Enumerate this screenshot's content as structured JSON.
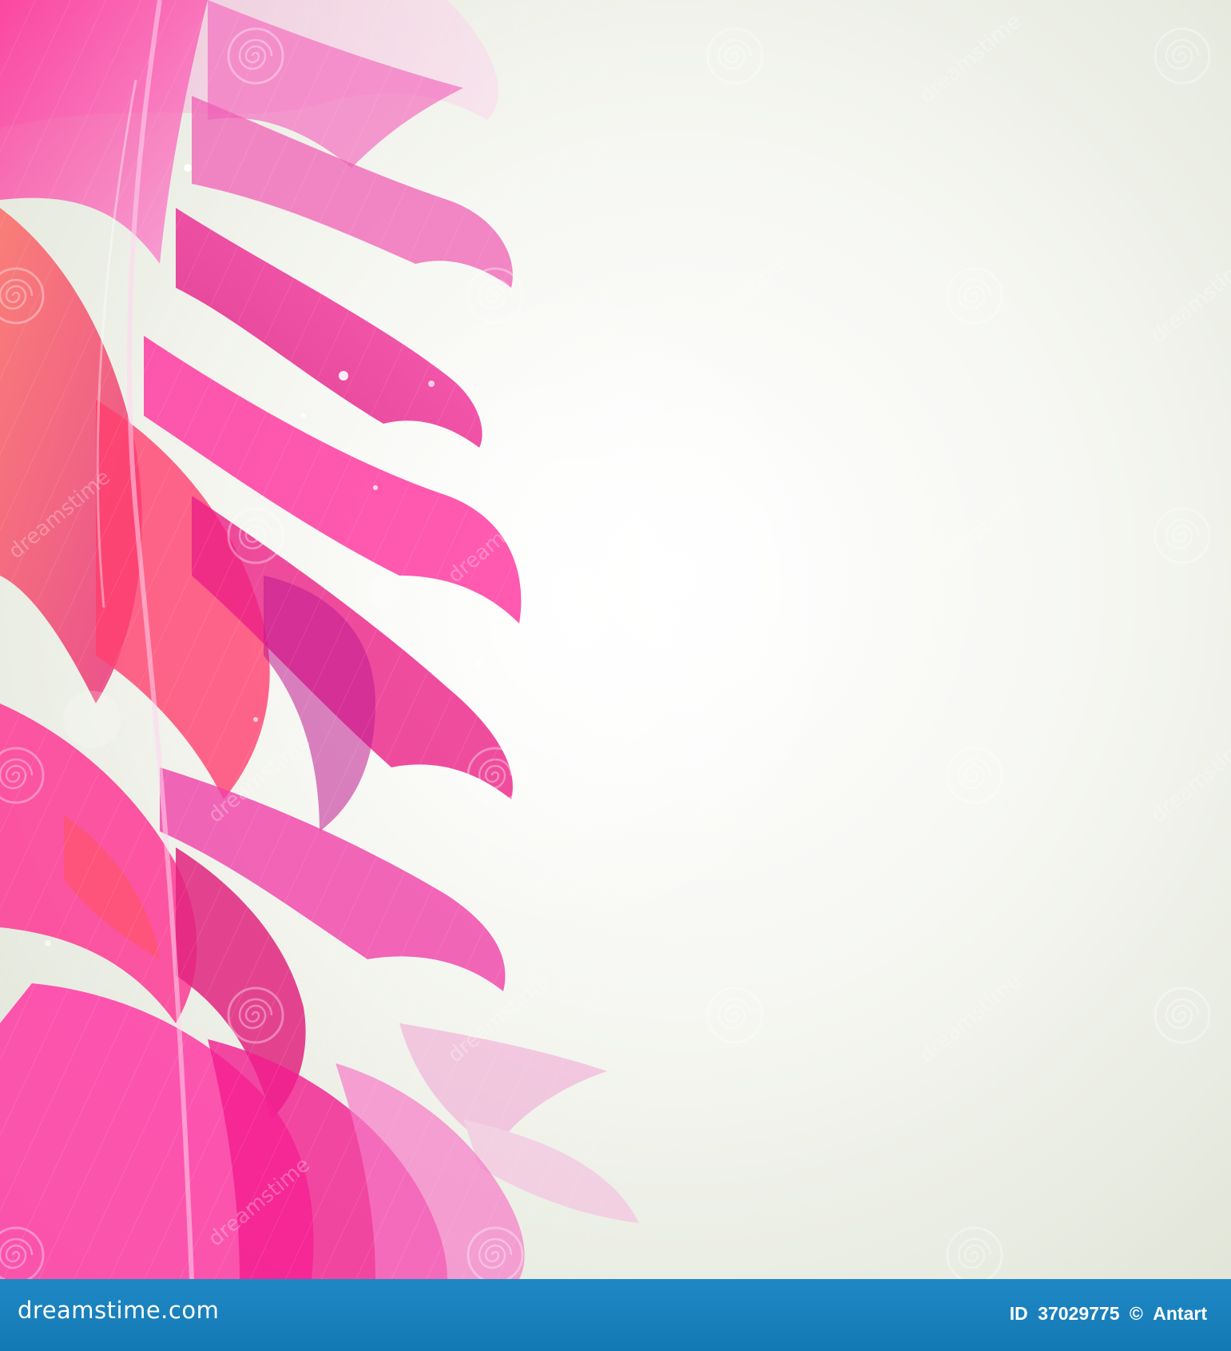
{
  "image": {
    "subject": "pink floral petals abstract background",
    "background_color": "#eef0e8",
    "petal_colors": [
      "#ff2d9a",
      "#e9168a",
      "#ff4f5e",
      "#f57cc8",
      "#e03a86"
    ]
  },
  "watermark": {
    "brand": "dreamstime",
    "swirl_icon": "spiral-swirl-icon"
  },
  "footer": {
    "logo_text": "dreamstime.com",
    "id_label": "ID",
    "id_number": "37029775",
    "copyright_symbol": "©",
    "author": "Antart",
    "bar_color": "#1a82bf"
  }
}
